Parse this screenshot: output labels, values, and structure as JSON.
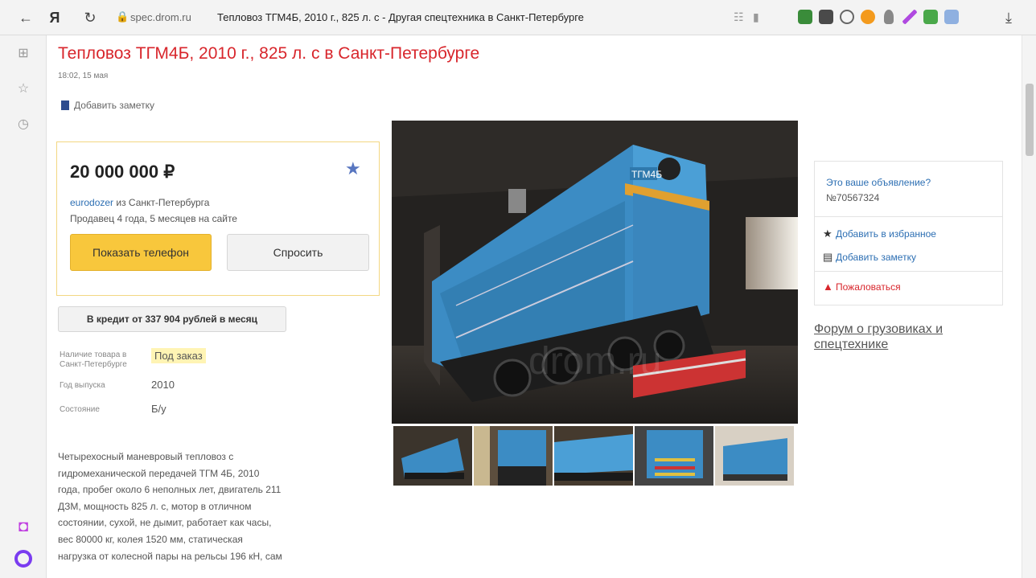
{
  "browser": {
    "domain": "spec.drom.ru",
    "page_title": "Тепловоз ТГМ4Б, 2010 г., 825 л. с - Другая спецтехника в Санкт-Петербурге",
    "yandex_glyph": "Я"
  },
  "listing": {
    "title": "Тепловоз ТГМ4Б, 2010 г., 825 л. с в Санкт-Петербурге",
    "date": "18:02, 15 мая",
    "add_note": "Добавить заметку",
    "price": "20 000 000 ₽",
    "seller_name": "eurodozer",
    "seller_city": " из Санкт-Петербурга",
    "seller_tenure": "Продавец 4 года, 5 месяцев на сайте",
    "show_phone": "Показать телефон",
    "ask": "Спросить",
    "credit": "В кредит от 337 904 рублей в месяц"
  },
  "specs": [
    {
      "label": "Наличие товара в Санкт-Петербурге",
      "value": "Под заказ"
    },
    {
      "label": "Год выпуска",
      "value": "2010"
    },
    {
      "label": "Состояние",
      "value": "Б/у"
    }
  ],
  "description": "Четырехосный маневровый тепловоз с гидромеханической передачей ТГМ 4Б, 2010 года, пробег около 6 неполных лет, двигатель 211 ДЗМ, мощность 825 л. с, мотор в отличном состоянии, сухой, не дымит, работает как часы, вес 80000 кг, колея 1520 мм, статическая нагрузка от колесной пары на рельсы 196 кН, сам",
  "photo": {
    "loco_label": "ТГМ4Б",
    "watermark": "drom.ru"
  },
  "side": {
    "your_ad": "Это ваше объявление?",
    "ad_number": "№70567324",
    "add_favorite": "Добавить в избранное",
    "add_note": "Добавить заметку",
    "report": "Пожаловаться",
    "forum": "Форум о грузовиках и спецтехнике"
  },
  "colors": {
    "title_red": "#d8262c",
    "link_blue": "#2d6fb3",
    "phone_yellow": "#f8c73c",
    "loco_blue": "#3f8fc6"
  }
}
